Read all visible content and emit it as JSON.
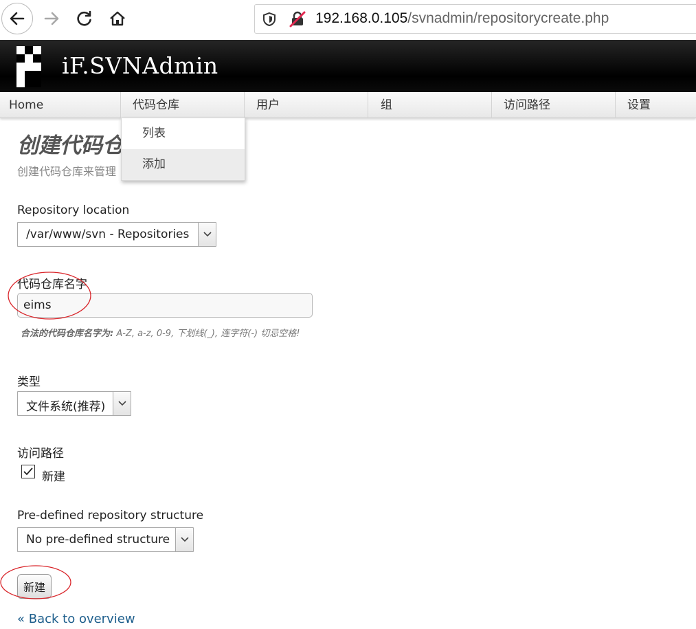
{
  "browser": {
    "url_host": "192.168.0.105",
    "url_path": "/svnadmin/repositorycreate.php"
  },
  "app": {
    "title": "iF.SVNAdmin"
  },
  "menu": {
    "items": [
      {
        "label": "Home"
      },
      {
        "label": "代码仓库"
      },
      {
        "label": "用户"
      },
      {
        "label": "组"
      },
      {
        "label": "访问路径"
      },
      {
        "label": "设置"
      }
    ],
    "dropdown": [
      {
        "label": "列表"
      },
      {
        "label": "添加"
      }
    ]
  },
  "page": {
    "title": "创建代码仓库",
    "subtitle": "创建代码仓库来管理"
  },
  "form": {
    "location_label": "Repository location",
    "location_value": "/var/www/svn - Repositories",
    "name_label": "代码仓库名字",
    "name_value": "eims",
    "name_hint_strong": "合法的代码仓库名字为:",
    "name_hint_text": " A-Z, a-z, 0-9, 下划线(_), 连字符(-) 切忌空格!",
    "type_label": "类型",
    "type_value": "文件系统(推荐)",
    "access_label": "访问路径",
    "access_checkbox_label": "新建",
    "structure_label": "Pre-defined repository structure",
    "structure_value": "No pre-defined structure",
    "submit_label": "新建",
    "back_link": "« Back to overview"
  },
  "colors": {
    "header_bg": "#000000",
    "link": "#1d5e8c",
    "annotation": "#d9252a"
  },
  "icons": [
    "back-arrow-icon",
    "forward-arrow-icon",
    "reload-icon",
    "home-icon",
    "shield-icon",
    "insecure-lock-icon",
    "logo-icon",
    "chevron-down-icon",
    "checkmark-icon"
  ]
}
